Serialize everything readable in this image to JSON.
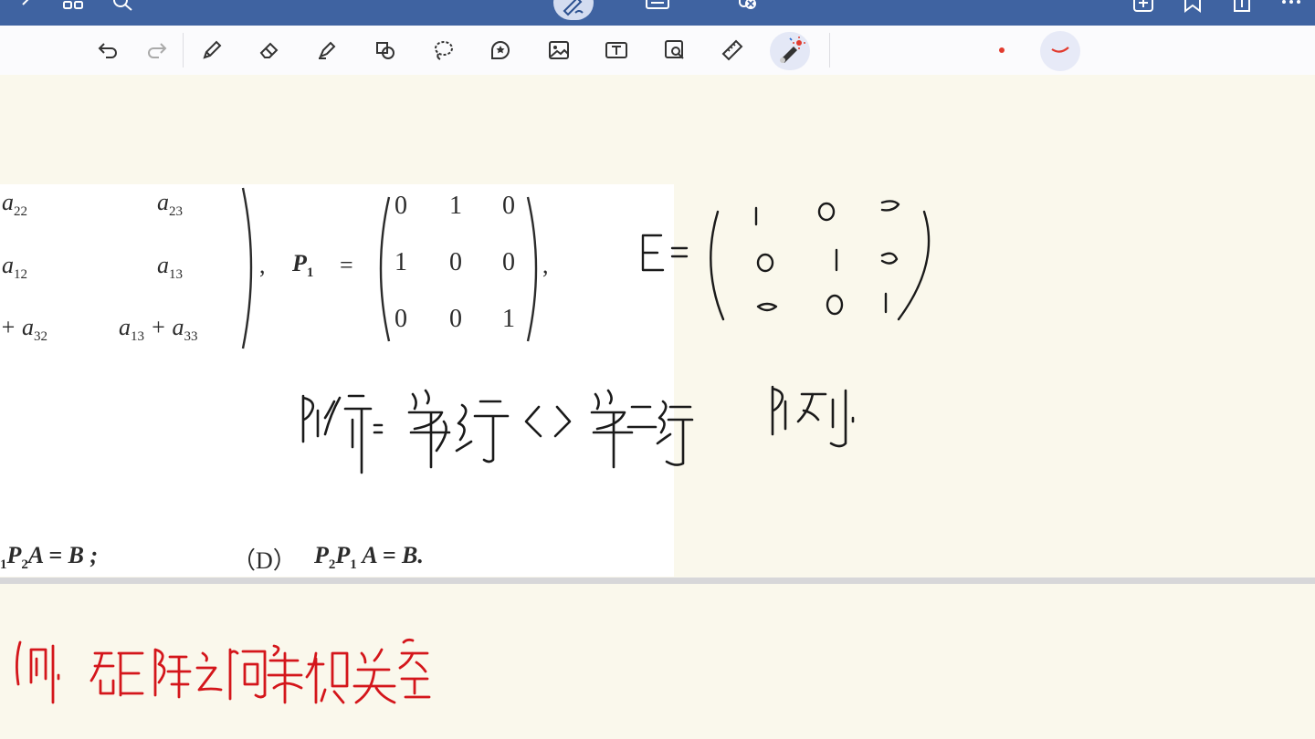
{
  "statusbar": {
    "icons": [
      "back-icon",
      "grid-icon",
      "search-icon",
      "pen-mode-icon",
      "keyboard-icon",
      "mic-off-icon",
      "add-page-icon",
      "bookmark-icon",
      "share-icon",
      "more-icon"
    ]
  },
  "toolbar": {
    "tools": [
      "undo",
      "redo",
      "pen",
      "eraser",
      "highlighter",
      "shapes",
      "lasso",
      "sticker",
      "image",
      "text",
      "zoom-image",
      "ruler",
      "laser-pointer"
    ],
    "selected_tool": "laser-pointer",
    "pen_color": "#e23b2e"
  },
  "snippet": {
    "matrix_A_rows": [
      {
        "c1": "a",
        "c1s": "22",
        "c2": "a",
        "c2s": "23"
      },
      {
        "c1": "a",
        "c1s": "12",
        "c2": "a",
        "c2s": "13"
      },
      {
        "c1": "+ a",
        "c1s": "32",
        "c2": "a",
        "c2s": "13"
      }
    ],
    "row3_tail_op": "+ a",
    "row3_tail_sub": "33",
    "comma1": ",",
    "p1_label": "P",
    "p1_sub": "1",
    "equals": "=",
    "p1_matrix": [
      [
        "0",
        "1",
        "0"
      ],
      [
        "1",
        "0",
        "0"
      ],
      [
        "0",
        "0",
        "1"
      ]
    ],
    "comma2": ",",
    "option_c_tail": "P",
    "option_c_tail_sub": "2",
    "option_c_rest": "A = B ;",
    "option_d_label": "（D）",
    "option_d_formula_p": "P",
    "option_d_formula_p2": "2",
    "option_d_formula_p_b": "P",
    "option_d_formula_p1": "1",
    "option_d_formula_rest": "A = B."
  },
  "colors": {
    "ink_black": "#1a1a1a",
    "ink_red": "#d4161b",
    "paper": "#faf8ec",
    "statusbar": "#3f63a1"
  }
}
